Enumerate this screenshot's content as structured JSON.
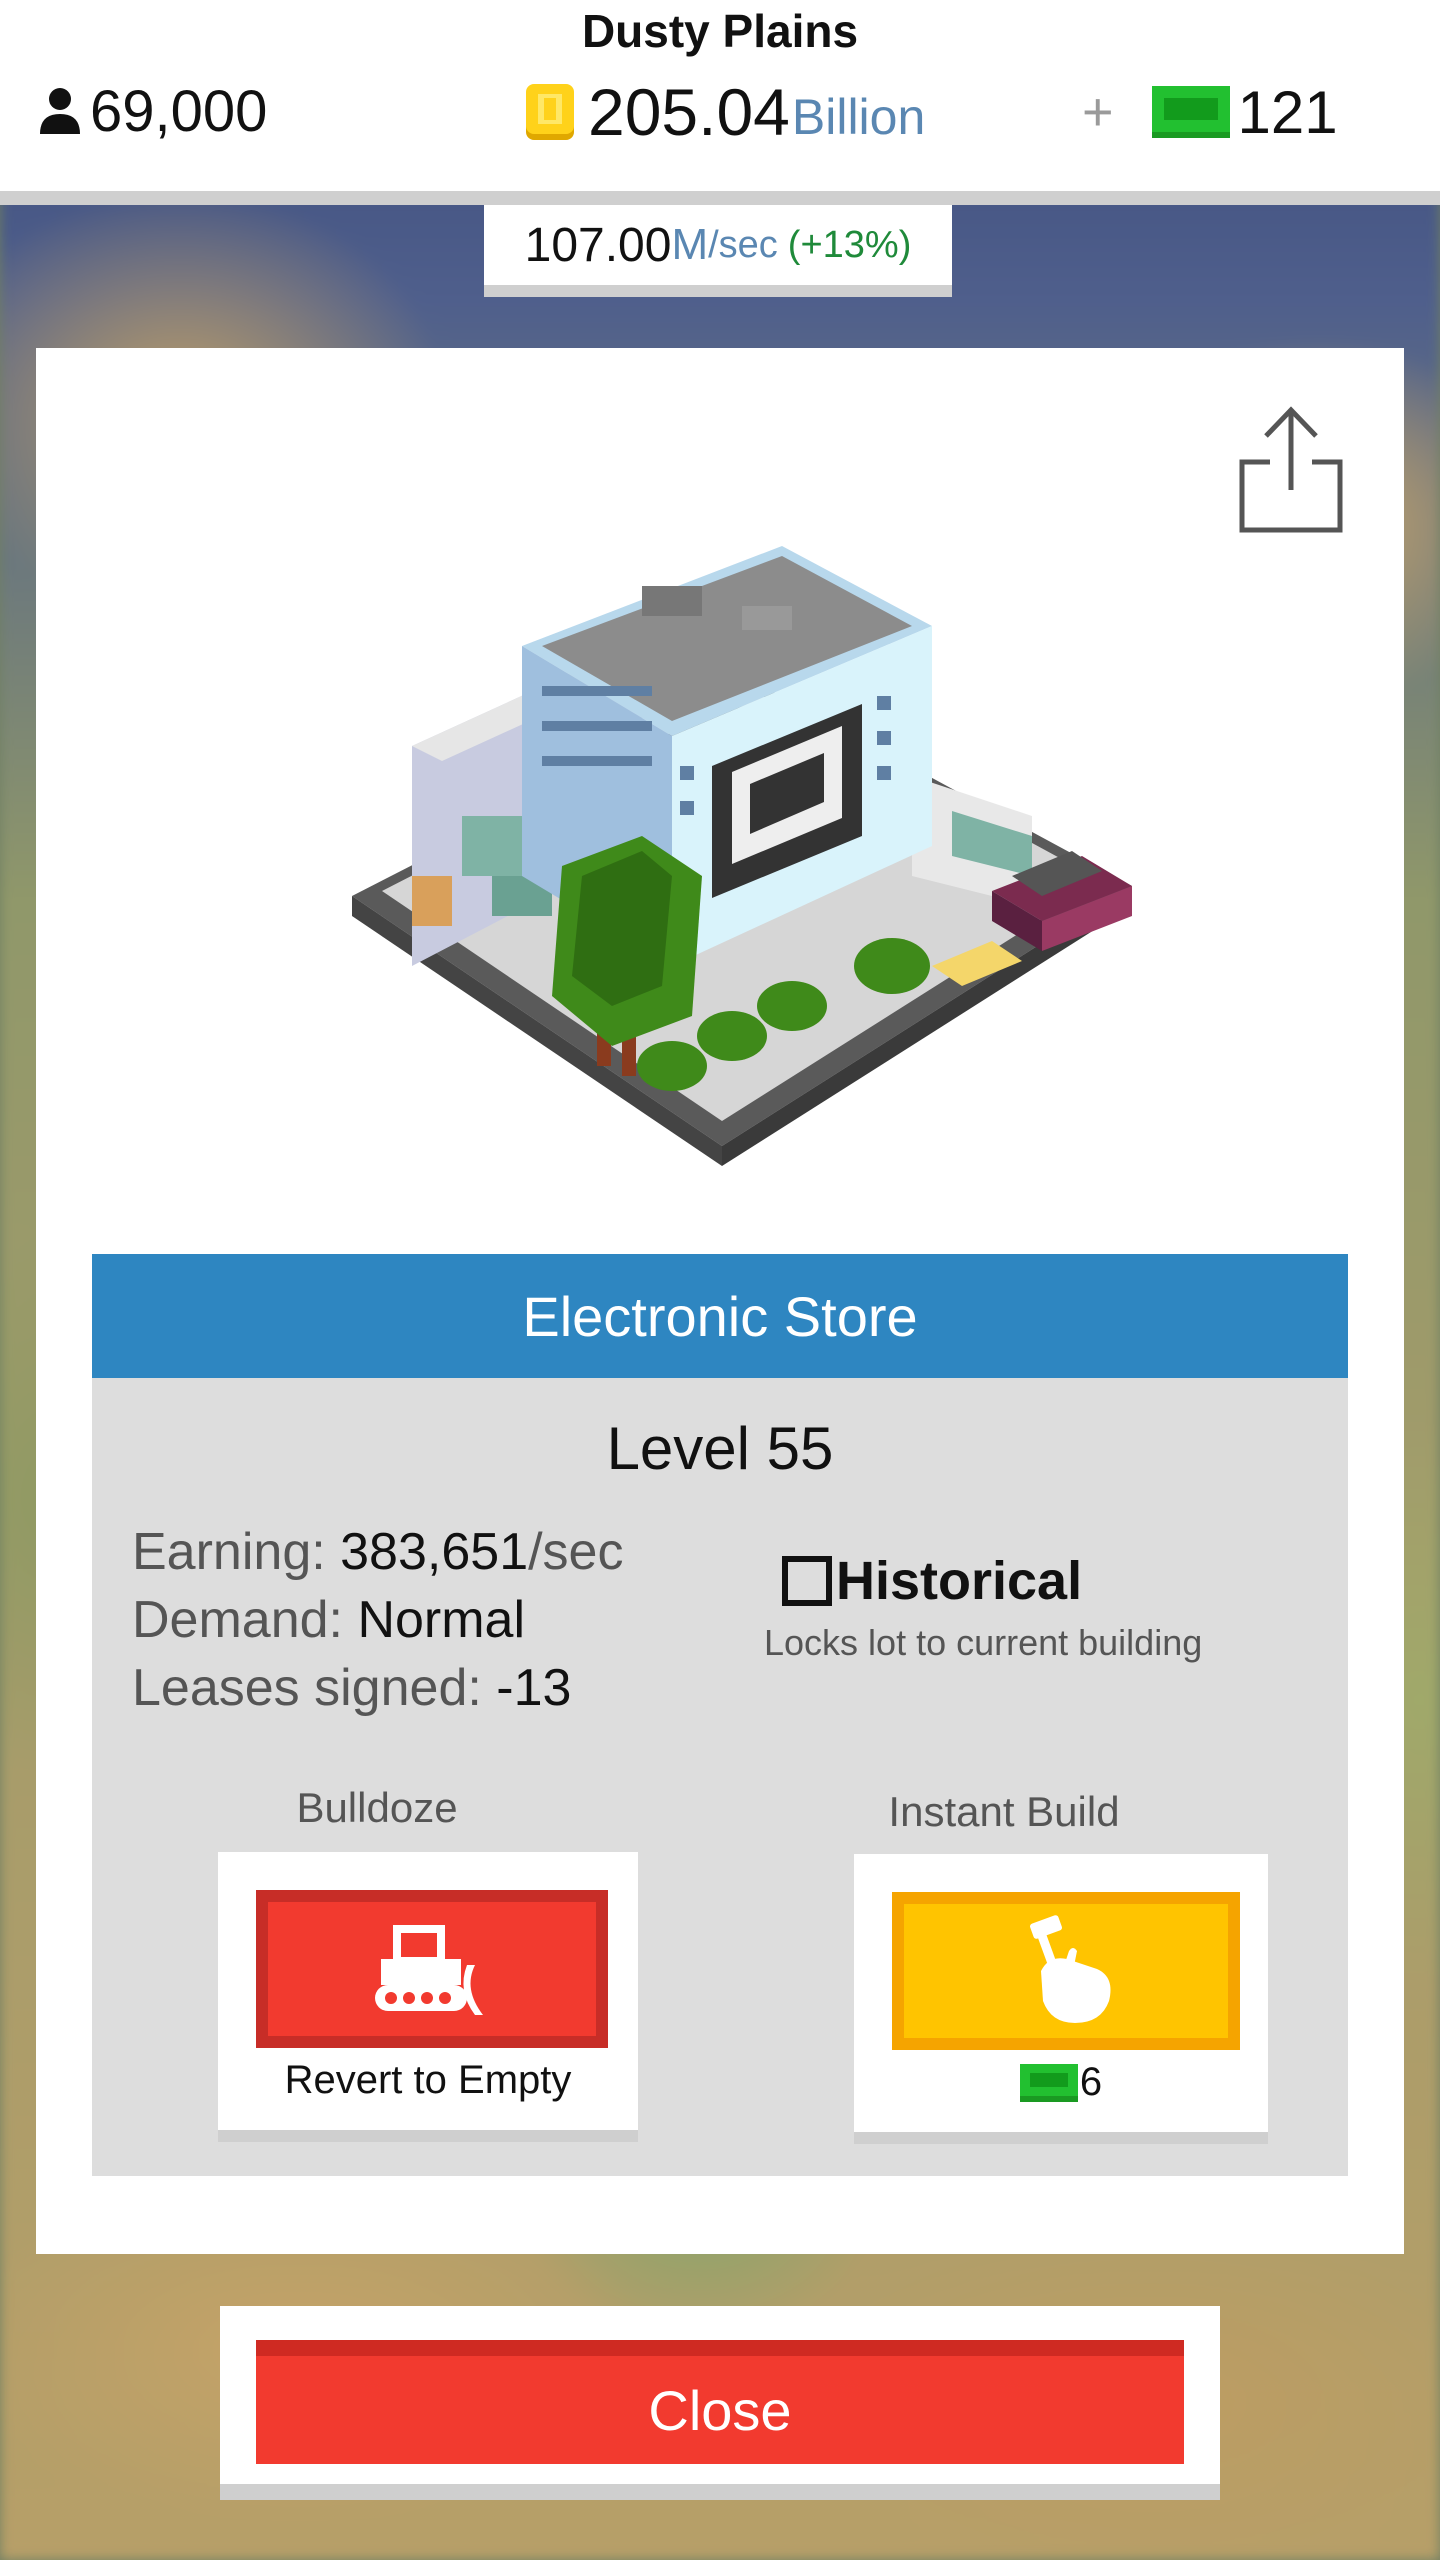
{
  "header": {
    "city_name": "Dusty Plains",
    "population": "69,000",
    "money_value": "205.04",
    "money_unit": "Billion",
    "plus_symbol": "+",
    "cash_count": "121",
    "rate_value": "107.00",
    "rate_unit": "M",
    "rate_unit_suffix": "/sec",
    "rate_bonus": "(+13%)"
  },
  "icons": {
    "population": "person-icon",
    "money": "gold-coin-icon",
    "cash": "green-bill-icon",
    "share": "share-icon",
    "bulldoze": "bulldozer-icon",
    "instant_build": "hammer-hand-icon"
  },
  "building": {
    "name": "Electronic Store",
    "level": "Level 55",
    "earning_label": "Earning:",
    "earning_value": "383,651",
    "earning_unit": "/sec",
    "demand_label": "Demand:",
    "demand_value": "Normal",
    "leases_label": "Leases signed:",
    "leases_value": "-13",
    "historical_label": "Historical",
    "historical_checked": false,
    "historical_desc": "Locks lot to current building"
  },
  "actions": {
    "bulldoze_label": "Bulldoze",
    "bulldoze_caption": "Revert to Empty",
    "instant_label": "Instant Build",
    "instant_cost": "6"
  },
  "footer": {
    "close_label": "Close"
  },
  "colors": {
    "title_bar": "#2e86c1",
    "danger": "#f23a2f",
    "gold": "#ffc400",
    "cash_green": "#22c030",
    "rate_bonus": "#1f8a3a",
    "unit_blue": "#5a87b2"
  }
}
